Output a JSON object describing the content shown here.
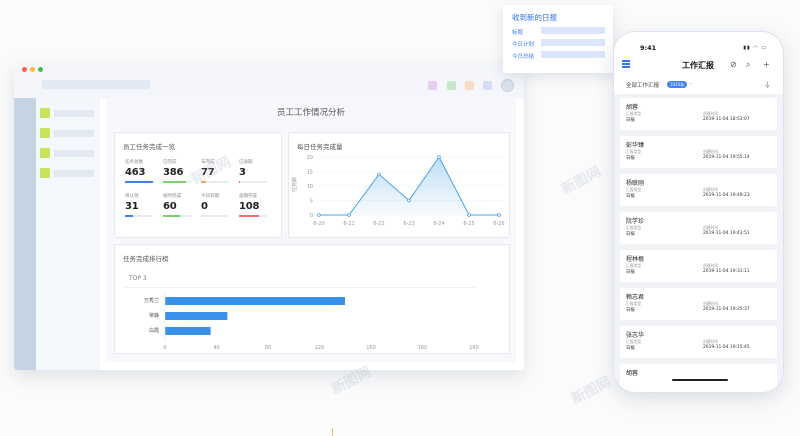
{
  "desktop": {
    "toolbar_colors": [
      "#e7cdf3",
      "#c8e7c8",
      "#f8dcc5",
      "#d6dbf7"
    ],
    "sidebar_accent": "#c8e35f",
    "page_title": "员工工作情况分析",
    "overview": {
      "title": "员工任务完成一览",
      "stats": [
        {
          "label": "任务总数",
          "value": "463",
          "progress": 1.0,
          "color": "#3f83f0"
        },
        {
          "label": "已完成",
          "value": "386",
          "progress": 0.83,
          "color": "#7fd16d"
        },
        {
          "label": "未完成",
          "value": "77",
          "progress": 0.17,
          "color": "#f7a35c"
        },
        {
          "label": "已逾期",
          "value": "3",
          "progress": 0.05,
          "color": "#f56d6d"
        },
        {
          "label": "待认领",
          "value": "31",
          "progress": 0.3,
          "color": "#3f83f0"
        },
        {
          "label": "按时完成",
          "value": "60",
          "progress": 0.6,
          "color": "#7fd16d"
        },
        {
          "label": "今日到期",
          "value": "0",
          "progress": 0.0,
          "color": "#f7a35c"
        },
        {
          "label": "逾期完成",
          "value": "108",
          "progress": 0.7,
          "color": "#f56d6d"
        }
      ]
    },
    "daily": {
      "title": "每日任务完成量",
      "ylabel": "任务数"
    },
    "ranking": {
      "title": "任务完成排行榜",
      "subtitle": "TOP 3"
    }
  },
  "chart_data": [
    {
      "type": "area",
      "title": "每日任务完成量",
      "ylabel": "任务数",
      "x": [
        "6-20",
        "6-21",
        "6-22",
        "6-23",
        "6-24",
        "6-25",
        "6-26"
      ],
      "series": [
        {
          "values": [
            0,
            0,
            14,
            5,
            20,
            0,
            0
          ]
        }
      ],
      "ylim": [
        0,
        20
      ],
      "yticks": [
        0,
        5,
        10,
        15,
        20
      ],
      "color": "#4aa3e8"
    },
    {
      "type": "bar",
      "orientation": "horizontal",
      "title": "任务完成排行榜",
      "categories": [
        "万秀兰",
        "常静",
        "白霞"
      ],
      "values": [
        150,
        52,
        38
      ],
      "xticks": [
        "0",
        "40",
        "80",
        "120",
        "160",
        "160",
        "160"
      ],
      "color": "#3a91ea"
    }
  ],
  "notification": {
    "title": "收到新的日报",
    "rows": [
      "标题",
      "今日计划",
      "今日总结"
    ]
  },
  "phone": {
    "time": "9:41",
    "status": "▮▮ ◠ ▭",
    "title": "工作汇报",
    "icons": [
      "slash-circle-icon",
      "search-icon",
      "plus-icon"
    ],
    "filter": "全部工作汇报",
    "badge": "1025条",
    "reports": [
      {
        "name": "胡蓉",
        "type_label": "汇报类型",
        "type": "日报",
        "time_label": "创建时间",
        "time": "2019-11-04 18:53:07"
      },
      {
        "name": "彭华臻",
        "type_label": "汇报类型",
        "type": "日报",
        "time_label": "创建时间",
        "time": "2019-11-04 19:55:14"
      },
      {
        "name": "杨联刚",
        "type_label": "汇报类型",
        "type": "日报",
        "time_label": "创建时间",
        "time": "2019-11-04 19:49:23"
      },
      {
        "name": "阮学珍",
        "type_label": "汇报类型",
        "type": "日报",
        "time_label": "创建时间",
        "time": "2019-11-04 19:43:51"
      },
      {
        "name": "程林根",
        "type_label": "汇报类型",
        "type": "日报",
        "time_label": "创建时间",
        "time": "2019-11-04 19:31:11"
      },
      {
        "name": "赖志君",
        "type_label": "汇报类型",
        "type": "日报",
        "time_label": "创建时间",
        "time": "2019-11-04 19:25:37"
      },
      {
        "name": "张志华",
        "type_label": "汇报类型",
        "type": "日报",
        "time_label": "创建时间",
        "time": "2019-11-04 19:15:45"
      },
      {
        "name": "胡蓉",
        "type_label": "",
        "type": "",
        "time_label": "",
        "time": ""
      }
    ]
  },
  "watermark": "新图网"
}
